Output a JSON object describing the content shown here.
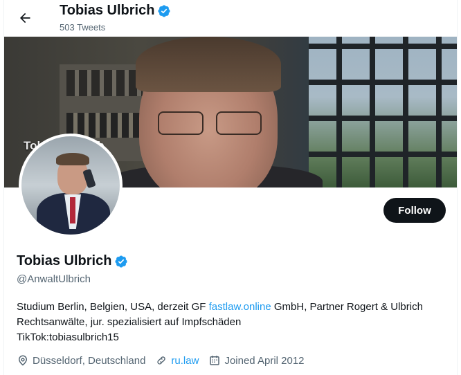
{
  "header": {
    "title": "Tobias Ulbrich",
    "tweet_count": "503 Tweets"
  },
  "banner": {
    "overlay_text": "Tobias Ulbrich"
  },
  "profile": {
    "name": "Tobias Ulbrich",
    "handle": "@AnwaltUlbrich",
    "follow_label": "Follow",
    "bio": {
      "part1": "Studium Berlin, Belgien, USA, derzeit GF ",
      "link": "fastlaw.online",
      "part2": " GmbH, Partner Rogert & Ulbrich Rechtsanwälte, jur. spezialisiert auf Impfschäden",
      "line3": "TikTok:tobiasulbrich15"
    },
    "location": "Düsseldorf, Deutschland",
    "website": "ru.law",
    "joined": "Joined April 2012"
  },
  "colors": {
    "accent": "#1d9bf0",
    "text": "#0f1419",
    "secondary": "#536471",
    "verified": "#1d9bf0"
  },
  "icons": {
    "back": "arrow-left-icon",
    "verified": "verified-badge-icon",
    "location": "location-pin-icon",
    "link": "link-icon",
    "calendar": "calendar-icon"
  }
}
